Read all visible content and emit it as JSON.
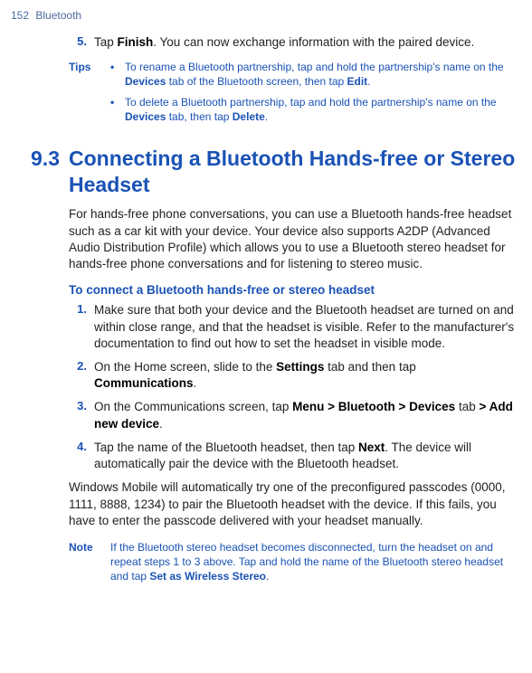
{
  "header": {
    "page_number": "152",
    "title": "Bluetooth"
  },
  "item5": {
    "num": "5.",
    "text_pre": "Tap ",
    "text_bold": "Finish",
    "text_post": ". You can now exchange information with the paired device."
  },
  "tips": {
    "label": "Tips",
    "items": [
      {
        "bullet": "•",
        "pre": "To rename a Bluetooth partnership, tap and hold the partnership's name on the ",
        "b1": "Devices",
        "mid": " tab of the Bluetooth screen, then tap ",
        "b2": "Edit",
        "post": "."
      },
      {
        "bullet": "•",
        "pre": "To delete a Bluetooth partnership, tap and hold the partnership's name on the ",
        "b1": "Devices",
        "mid": " tab, then tap ",
        "b2": "Delete",
        "post": "."
      }
    ]
  },
  "section": {
    "num": "9.3",
    "title": "Connecting a Bluetooth Hands-free or Stereo Headset"
  },
  "intro": "For hands-free phone conversations, you can use a Bluetooth hands-free headset such as a car kit with your device. Your device also supports A2DP (Advanced Audio Distribution Profile) which allows you to use a Bluetooth stereo headset for hands-free phone conversations and for listening to stereo music.",
  "subhead": "To connect a Bluetooth hands-free or stereo headset",
  "steps": [
    {
      "num": "1.",
      "text": "Make sure that both your device and the Bluetooth headset are turned on and within close range, and that the headset is visible. Refer to the manufacturer's documentation to find out how to set the headset in visible mode."
    },
    {
      "num": "2.",
      "pre": "On the Home screen, slide to the ",
      "b1": "Settings",
      "mid": " tab and then tap ",
      "b2": "Communications",
      "post": "."
    },
    {
      "num": "3.",
      "pre": "On the Communications screen, tap ",
      "b1": "Menu",
      "sep1": " > ",
      "b2": "Bluetooth",
      "sep2": " > ",
      "b3": "Devices",
      "mid": " tab ",
      "sep3": "> ",
      "b4": "Add new device",
      "post": "."
    },
    {
      "num": "4.",
      "pre": "Tap the name of the Bluetooth headset, then tap ",
      "b1": "Next",
      "post": ". The device will automatically pair the device with the Bluetooth headset."
    }
  ],
  "closing": "Windows Mobile will automatically try one of the preconfigured passcodes (0000, 1111, 8888, 1234) to pair the Bluetooth headset with the device. If this fails, you have to enter the passcode delivered with your headset manually.",
  "note": {
    "label": "Note",
    "pre": "If the Bluetooth stereo headset becomes disconnected, turn the headset on and repeat steps 1 to 3 above. Tap and hold the name of the Bluetooth stereo headset and tap ",
    "b1": "Set as Wireless Stereo",
    "post": "."
  }
}
